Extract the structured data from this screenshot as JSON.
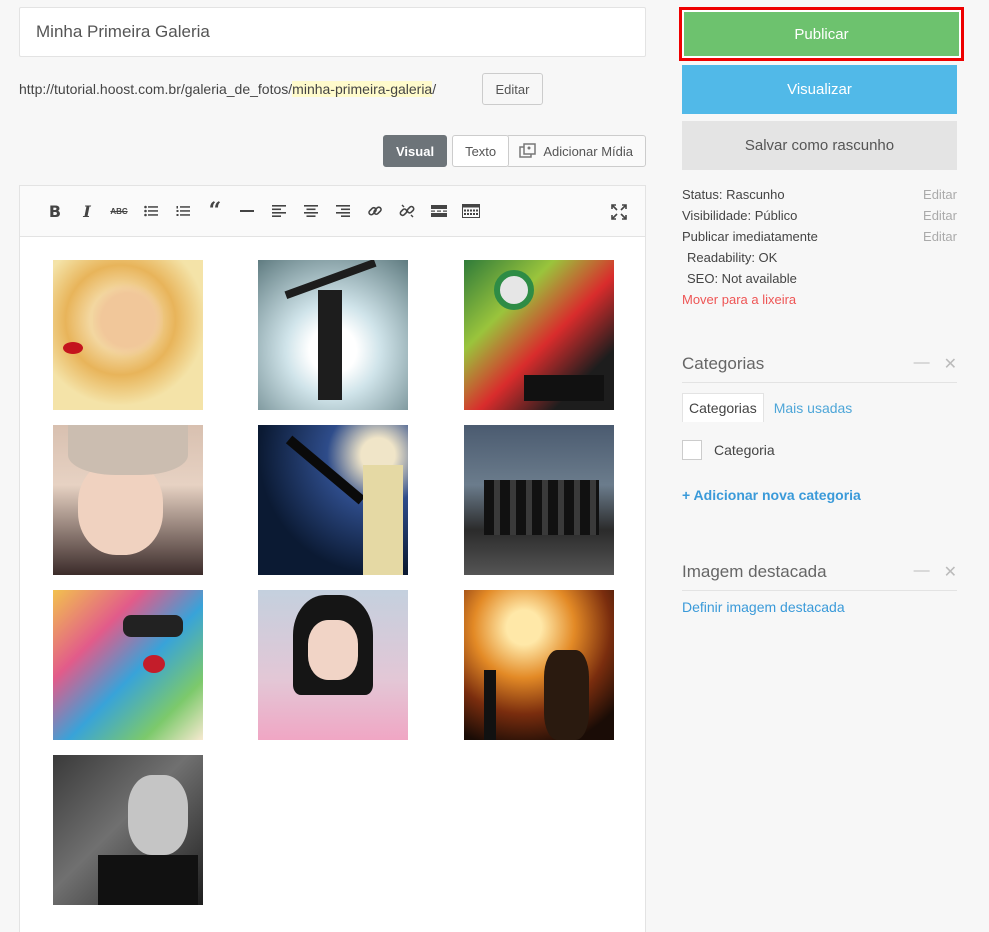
{
  "post": {
    "title": "Minha Primeira Galeria",
    "permalink_base": "http://tutorial.hoost.com.br/galeria_de_fotos/",
    "permalink_slug": "minha-primeira-galeria",
    "permalink_trail": "/",
    "edit_slug_label": "Editar"
  },
  "editor": {
    "tab_visual": "Visual",
    "tab_text": "Texto",
    "add_media": "Adicionar Mídia",
    "toolbar": [
      "bold",
      "italic",
      "strikethrough",
      "bullet-list",
      "numbered-list",
      "blockquote",
      "horizontal-rule",
      "align-left",
      "align-center",
      "align-right",
      "insert-link",
      "remove-link",
      "read-more",
      "toolbar-toggle",
      "fullscreen"
    ],
    "gallery_count": 10
  },
  "publish": {
    "publish_label": "Publicar",
    "preview_label": "Visualizar",
    "draft_label": "Salvar como rascunho",
    "status": "Status: Rascunho",
    "visibility": "Visibilidade: Público",
    "schedule": "Publicar imediatamente",
    "edit_label": "Editar",
    "readability": "Readability: OK",
    "seo": "SEO: Not available",
    "trash": "Mover para a lixeira"
  },
  "categories": {
    "title": "Categorias",
    "tab_all": "Categorias",
    "tab_popular": "Mais usadas",
    "items": [
      "Categoria"
    ],
    "add_new": "+ Adicionar nova categoria"
  },
  "featured_image": {
    "title": "Imagem destacada",
    "set_label": "Definir imagem destacada"
  },
  "colors": {
    "publish": "#6dc26e",
    "preview": "#51b9e8",
    "highlight_border": "#ee0000",
    "link": "#3a9ad9",
    "trash": "#ee5555"
  }
}
